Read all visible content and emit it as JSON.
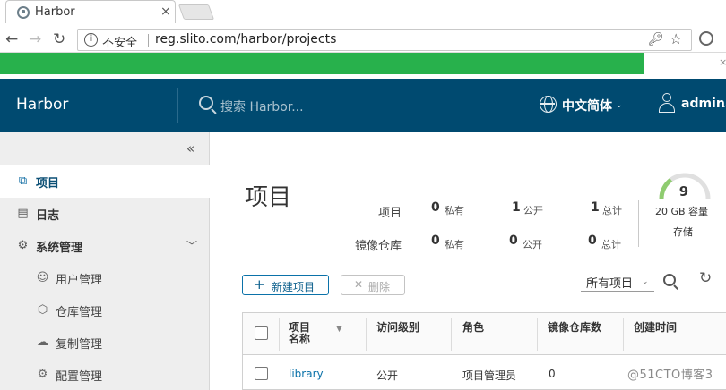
{
  "browser": {
    "tab_title": "Harbor",
    "tab_close": "×",
    "security_label": "不安全",
    "url": "reg.slito.com/harbor/projects",
    "page_load_progress": 0.886
  },
  "header": {
    "brand": "Harbor",
    "search_placeholder": "搜索 Harbor...",
    "language": "中文简体",
    "user": "admin",
    "colors": {
      "background": "#004a70"
    }
  },
  "sidebar": {
    "collapse_glyph": "«",
    "items": [
      {
        "label": "项目",
        "icon": "projects-icon",
        "active": true
      },
      {
        "label": "日志",
        "icon": "logs-icon"
      },
      {
        "label": "系统管理",
        "icon": "admin-icon",
        "expanded": true
      }
    ],
    "subitems": [
      {
        "label": "用户管理",
        "icon": "users-icon"
      },
      {
        "label": "仓库管理",
        "icon": "registries-icon"
      },
      {
        "label": "复制管理",
        "icon": "replication-icon"
      },
      {
        "label": "配置管理",
        "icon": "configuration-icon"
      }
    ]
  },
  "main": {
    "title": "项目",
    "stats": {
      "row1_label": "项目",
      "row2_label": "镜像仓库",
      "private_label": "私有",
      "public_label": "公开",
      "total_label": "总计",
      "projects": {
        "private": "0",
        "public": "1",
        "total": "1"
      },
      "repositories": {
        "private": "0",
        "public": "0",
        "total": "0"
      }
    },
    "storage": {
      "value": "9",
      "capacity": "20 GB 容量",
      "label": "存储",
      "used_fraction": 0.3
    },
    "buttons": {
      "new_plus": "+",
      "new_project": "新建项目",
      "delete_x": "✕",
      "delete": "删除"
    },
    "filter": {
      "selected": "所有项目"
    },
    "table": {
      "columns": [
        "项目名称",
        "访问级别",
        "角色",
        "镜像仓库数",
        "创建时间"
      ],
      "rows": [
        {
          "name": "library",
          "access": "公开",
          "role": "项目管理员",
          "repo_count": "0",
          "created": ""
        }
      ]
    }
  },
  "watermark": "@51CTO博客3"
}
